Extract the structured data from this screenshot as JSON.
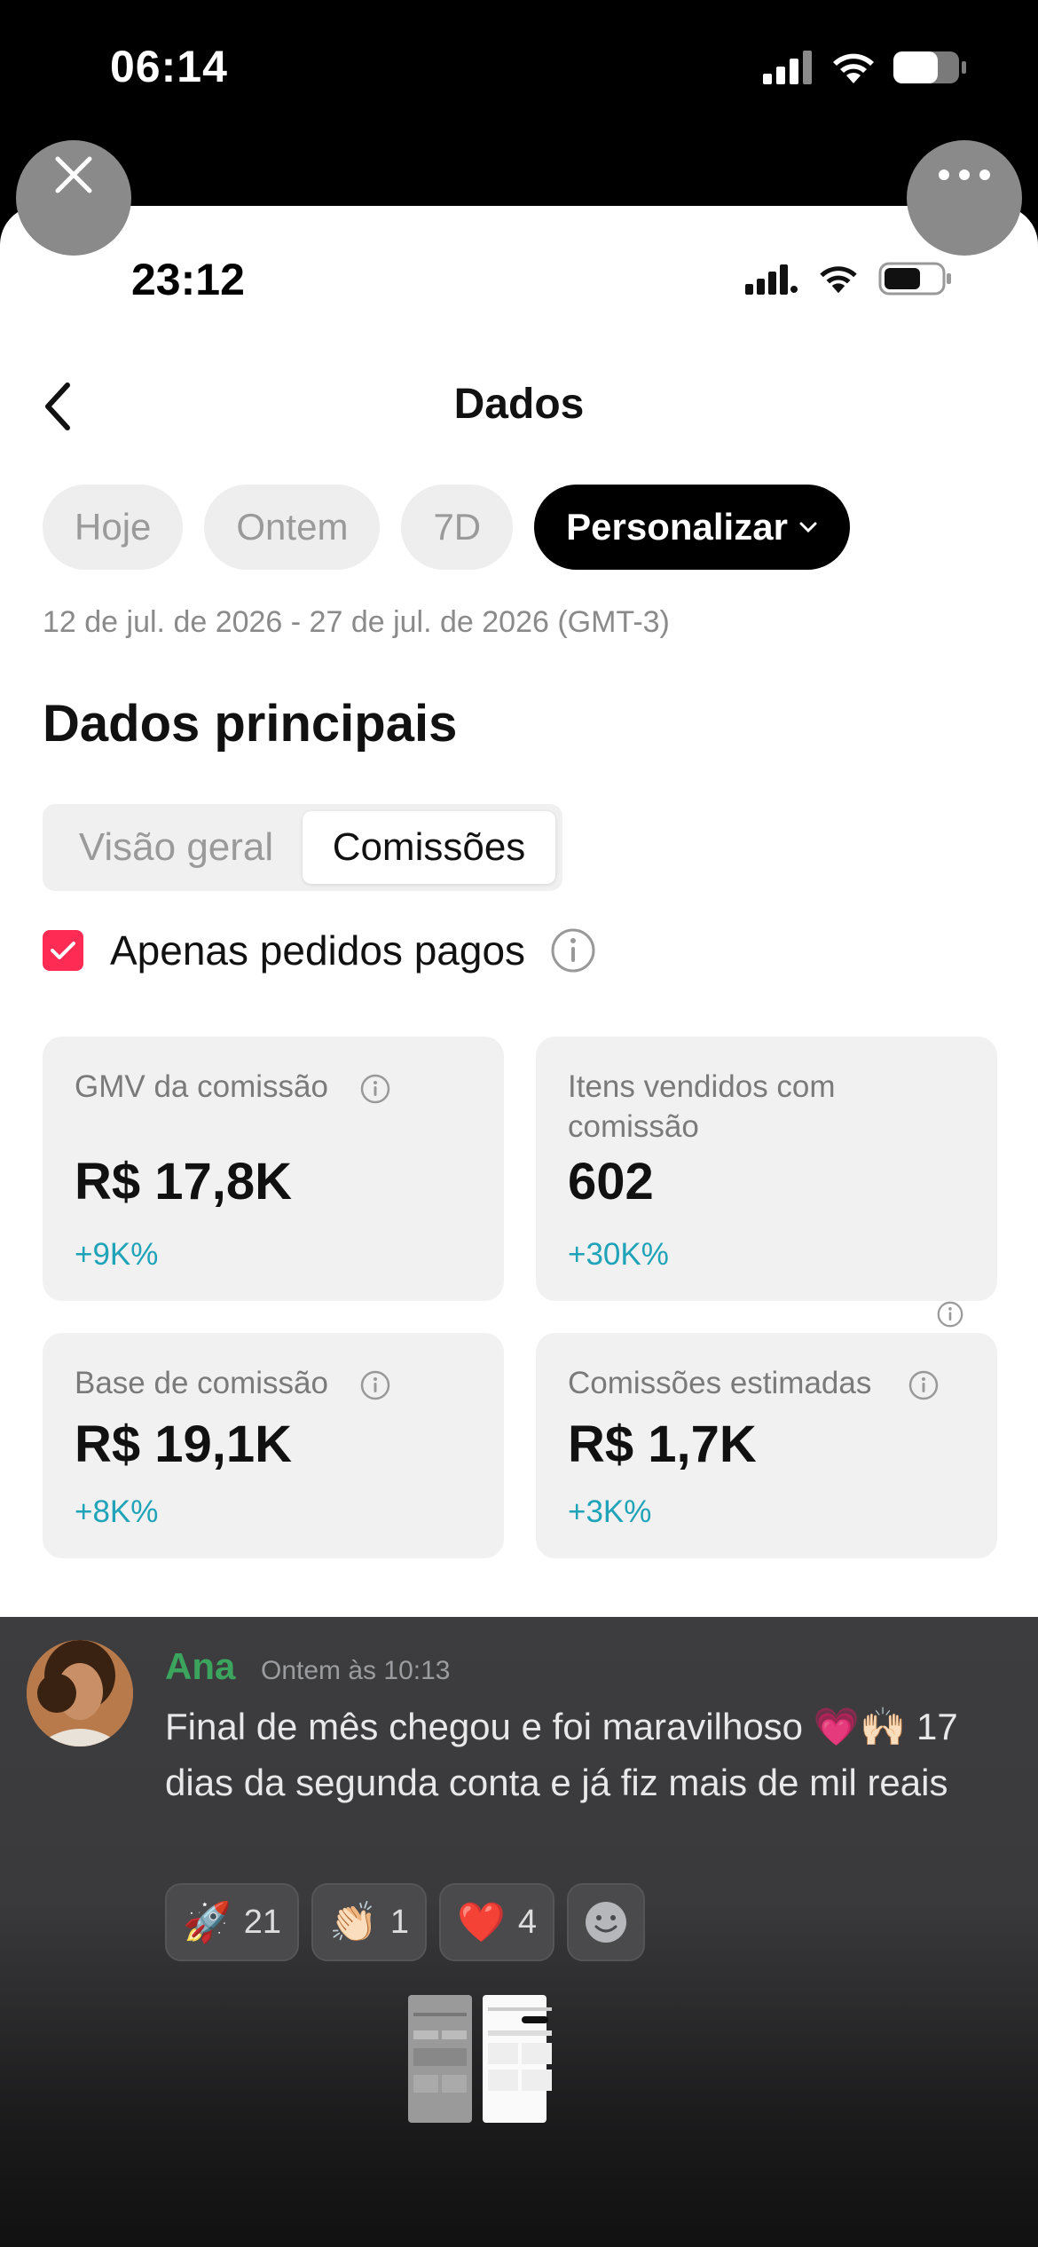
{
  "outer_status": {
    "time": "06:14"
  },
  "inner_status": {
    "time": "23:12"
  },
  "header": {
    "title": "Dados"
  },
  "chips": [
    {
      "label": "Hoje"
    },
    {
      "label": "Ontem"
    },
    {
      "label": "7D"
    },
    {
      "label": "Personalizar"
    }
  ],
  "date_range": "12 de jul. de 2026 - 27 de jul. de 2026 (GMT-3)",
  "section_title": "Dados principais",
  "segment": {
    "tab1": "Visão geral",
    "tab2": "Comissões"
  },
  "filter": {
    "label": "Apenas pedidos pagos",
    "checked": true
  },
  "cards": [
    {
      "label": "GMV da comissão",
      "value": "R$ 17,8K",
      "change": "+9K%"
    },
    {
      "label": "Itens vendidos com comissão",
      "value": "602",
      "change": "+30K%"
    },
    {
      "label": "Base de comissão",
      "value": "R$ 19,1K",
      "change": "+8K%"
    },
    {
      "label": "Comissões estimadas",
      "value": "R$ 1,7K",
      "change": "+3K%"
    }
  ],
  "chat": {
    "author": "Ana",
    "timestamp": "Ontem às 10:13",
    "message": "Final de mês chegou e foi maravilhoso 💗🙌🏻 17 dias da segunda conta e já fiz mais de mil reais",
    "reactions": [
      {
        "emoji": "🚀",
        "count": "21"
      },
      {
        "emoji": "👏🏻",
        "count": "1"
      },
      {
        "emoji": "❤️",
        "count": "4"
      }
    ]
  },
  "colors": {
    "accent": "#fe2c55",
    "change": "#1fa3b8",
    "author": "#3ba55d"
  }
}
